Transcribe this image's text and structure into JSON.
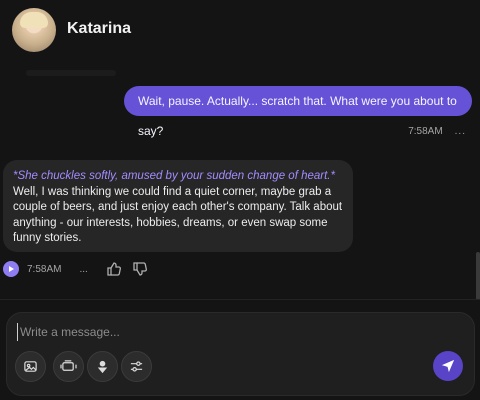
{
  "header": {
    "name": "Katarina",
    "avatar_icon": "avatar-icon"
  },
  "messages": {
    "user": {
      "text": "Wait, pause. Actually... scratch that. What were you about to say?",
      "time": "7:58AM",
      "more": "..."
    },
    "bot": {
      "action": "*She chuckles softly, amused by your sudden change of heart.*",
      "text": "Well, I was thinking we could find a quiet corner, maybe grab a couple of beers, and just enjoy each other's company. Talk about anything - our interests, hobbies, dreams, or even swap some funny stories.",
      "time": "7:58AM",
      "more": "..."
    }
  },
  "composer": {
    "placeholder": "Write a message..."
  },
  "colors": {
    "accent": "#6652d6",
    "send": "#5943c6",
    "action_text": "#a48cff"
  }
}
